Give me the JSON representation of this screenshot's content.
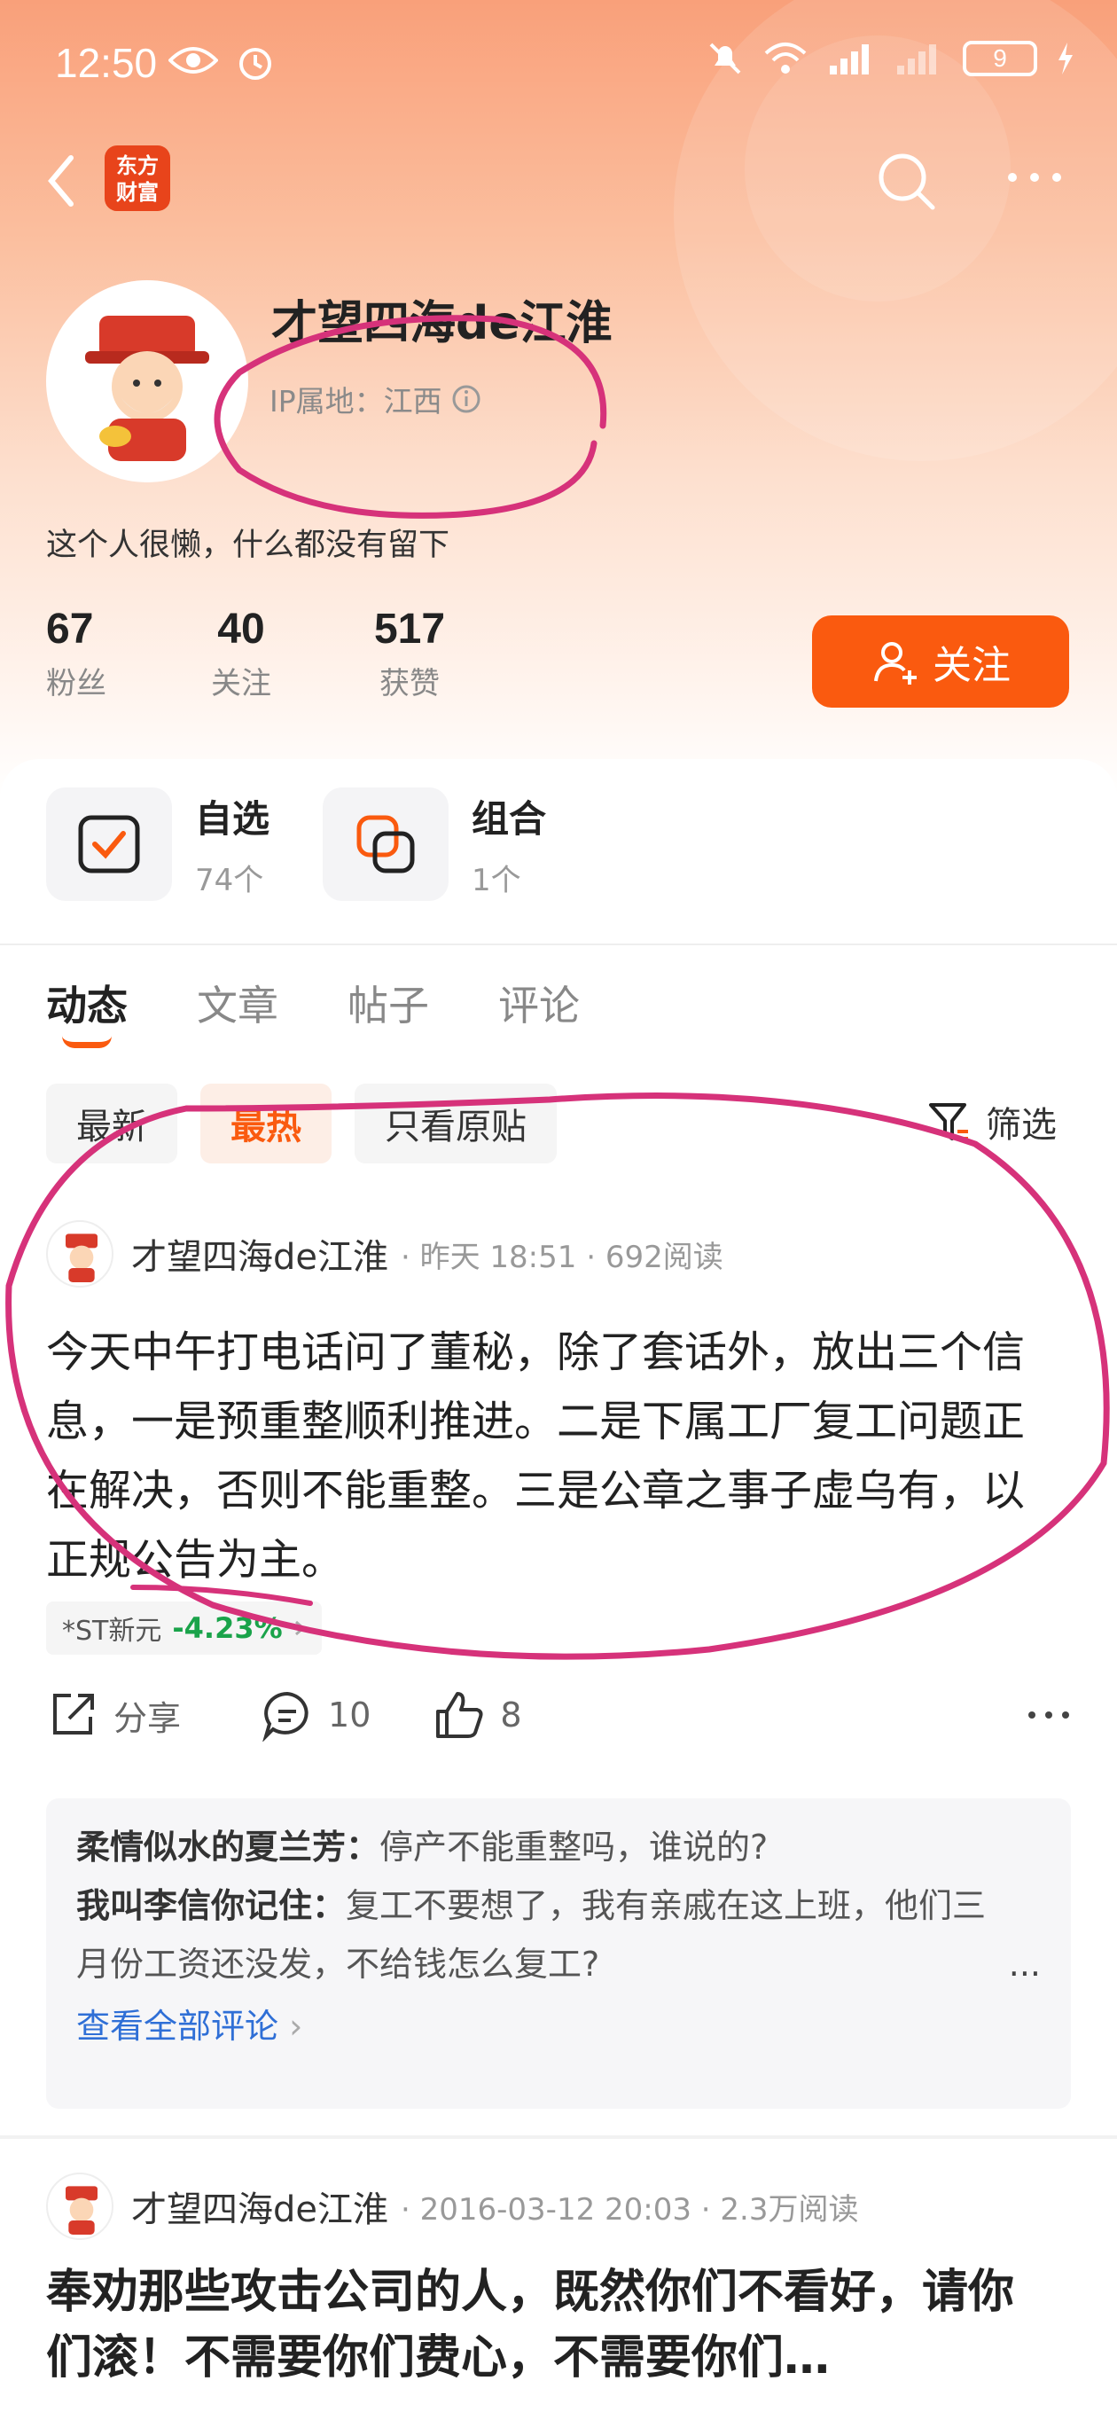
{
  "status_bar": {
    "time": "12:50",
    "battery": "9"
  },
  "nav": {
    "logo_line1": "东方",
    "logo_line2": "财富"
  },
  "profile": {
    "name": "才望四海de江淮",
    "ip_location": "IP属地：江西",
    "bio": "这个人很懒，什么都没有留下",
    "stats": [
      {
        "value": "67",
        "label": "粉丝"
      },
      {
        "value": "40",
        "label": "关注"
      },
      {
        "value": "517",
        "label": "获赞"
      }
    ],
    "follow_label": "关注"
  },
  "quick": [
    {
      "title": "自选",
      "sub": "74个"
    },
    {
      "title": "组合",
      "sub": "1个"
    }
  ],
  "tabs": [
    "动态",
    "文章",
    "帖子",
    "评论"
  ],
  "filters": [
    "最新",
    "最热",
    "只看原贴"
  ],
  "filter_label": "筛选",
  "posts": [
    {
      "author": "才望四海de江淮",
      "meta": "· 昨天 18:51 · 692阅读",
      "body": "今天中午打电话问了董秘，除了套话外，放出三个信息，一是预重整顺利推进。二是下属工厂复工问题正在解决，否则不能重整。三是公章之事子虚乌有，以正规公告为主。",
      "stock_name": "*ST新元",
      "stock_change": "-4.23%",
      "share_label": "分享",
      "comment_count": "10",
      "like_count": "8",
      "comments": [
        {
          "user": "柔情似水的夏兰芳：",
          "text": "停产不能重整吗，谁说的?"
        },
        {
          "user": "我叫李信你记住：",
          "text": "复工不要想了，我有亲戚在这上班，他们三月份工资还没发，不给钱怎么复工?"
        }
      ],
      "view_all": "查看全部评论",
      "more": "..."
    },
    {
      "author": "才望四海de江淮",
      "meta": "· 2016-03-12 20:03 · 2.3万阅读",
      "body": "奉劝那些攻击公司的人，既然你们不看好，请你们滚！不需要你们费心，不需要你们…"
    }
  ],
  "colors": {
    "accent": "#fa5a0f",
    "annotation": "#d6327a",
    "down": "#1aa34a",
    "link": "#2f6fd6"
  }
}
